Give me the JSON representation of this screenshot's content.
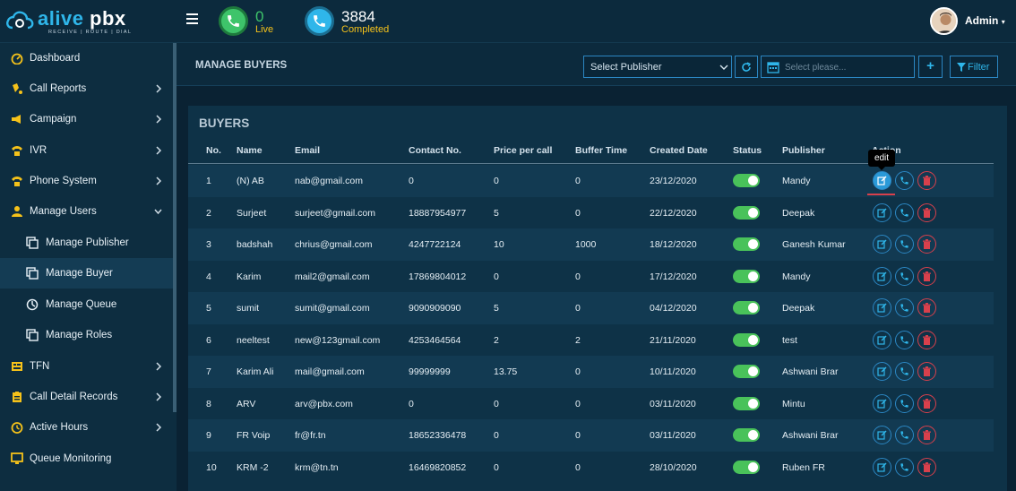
{
  "brand": {
    "name_part1": "alive",
    "name_part2": " pbx",
    "tagline": "RECEIVE | ROUTE | DIAL"
  },
  "header": {
    "live_count": "0",
    "live_label": "Live",
    "completed_count": "3884",
    "completed_label": "Completed",
    "user_label": "Admin"
  },
  "sidebar": {
    "items": [
      {
        "label": "Dashboard",
        "icon": "dashboard-icon",
        "chevron": false
      },
      {
        "label": "Call Reports",
        "icon": "call-reports-icon",
        "chevron": true
      },
      {
        "label": "Campaign",
        "icon": "megaphone-icon",
        "chevron": true
      },
      {
        "label": "IVR",
        "icon": "ivr-icon",
        "chevron": true
      },
      {
        "label": "Phone System",
        "icon": "phone-system-icon",
        "chevron": true
      },
      {
        "label": "Manage Users",
        "icon": "user-icon",
        "chevron": "down"
      },
      {
        "label": "Manage Publisher",
        "icon": "copy-icon",
        "sub": true
      },
      {
        "label": "Manage Buyer",
        "icon": "copy-icon",
        "sub": true,
        "active": true
      },
      {
        "label": "Manage Queue",
        "icon": "queue-icon",
        "sub": true
      },
      {
        "label": "Manage Roles",
        "icon": "copy-icon",
        "sub": true
      },
      {
        "label": "TFN",
        "icon": "tfn-icon",
        "chevron": true
      },
      {
        "label": "Call Detail Records",
        "icon": "clipboard-icon",
        "chevron": true
      },
      {
        "label": "Active Hours",
        "icon": "clock-icon",
        "chevron": true
      },
      {
        "label": "Queue Monitoring",
        "icon": "monitor-icon",
        "chevron": false
      }
    ]
  },
  "toolbar": {
    "page_title": "MANAGE BUYERS",
    "publisher_select": "Select Publisher",
    "date_placeholder": "Select please...",
    "add_label": "+",
    "filter_label": "Filter"
  },
  "panel": {
    "title": "BUYERS"
  },
  "table": {
    "headers": [
      "No.",
      "Name",
      "Email",
      "Contact No.",
      "Price per call",
      "Buffer Time",
      "Created Date",
      "Status",
      "Publisher",
      "Action"
    ],
    "rows": [
      [
        "1",
        "(N) AB",
        "nab@gmail.com",
        "0",
        "0",
        "0",
        "23/12/2020",
        "on",
        "Mandy"
      ],
      [
        "2",
        "Surjeet",
        "surjeet@gmail.com",
        "18887954977",
        "5",
        "0",
        "22/12/2020",
        "on",
        "Deepak"
      ],
      [
        "3",
        "badshah",
        "chrius@gmail.com",
        "4247722124",
        "10",
        "1000",
        "18/12/2020",
        "on",
        "Ganesh Kumar"
      ],
      [
        "4",
        "Karim",
        "mail2@gmail.com",
        "17869804012",
        "0",
        "0",
        "17/12/2020",
        "on",
        "Mandy"
      ],
      [
        "5",
        "sumit",
        "sumit@gmail.com",
        "9090909090",
        "5",
        "0",
        "04/12/2020",
        "on",
        "Deepak"
      ],
      [
        "6",
        "neeltest",
        "new@123gmail.com",
        "4253464564",
        "2",
        "2",
        "21/11/2020",
        "on",
        "test"
      ],
      [
        "7",
        "Karim Ali",
        "mail@gmail.com",
        "99999999",
        "13.75",
        "0",
        "10/11/2020",
        "on",
        "Ashwani Brar"
      ],
      [
        "8",
        "ARV",
        "arv@pbx.com",
        "0",
        "0",
        "0",
        "03/11/2020",
        "on",
        "Mintu"
      ],
      [
        "9",
        "FR Voip",
        "fr@fr.tn",
        "18652336478",
        "0",
        "0",
        "03/11/2020",
        "on",
        "Ashwani Brar"
      ],
      [
        "10",
        "KRM -2",
        "krm@tn.tn",
        "16469820852",
        "0",
        "0",
        "28/10/2020",
        "on",
        "Ruben FR"
      ]
    ]
  },
  "tooltip": {
    "text": "edit"
  },
  "colors": {
    "accent": "#2fb6ea",
    "live": "#3ec46a",
    "completed_label": "#f5c21a",
    "toggle_on": "#49c25a",
    "danger": "#d8404c"
  }
}
